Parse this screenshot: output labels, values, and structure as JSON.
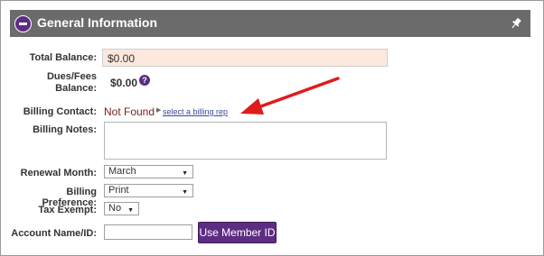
{
  "header": {
    "title": "General Information"
  },
  "fields": {
    "total_balance": {
      "label": "Total Balance:",
      "value": "$0.00"
    },
    "dues_fees_balance": {
      "label_line1": "Dues/Fees",
      "label_line2": "Balance:",
      "value": "$0.00",
      "help": "?"
    },
    "billing_contact": {
      "label": "Billing Contact:",
      "value": "Not Found",
      "link": "select a billing rep"
    },
    "billing_notes": {
      "label": "Billing Notes:",
      "value": ""
    },
    "renewal_month": {
      "label": "Renewal Month:",
      "selected": "March"
    },
    "billing_preference": {
      "label": "Billing Preference:",
      "selected": "Print"
    },
    "tax_exempt": {
      "label": "Tax Exempt:",
      "selected": "No"
    },
    "account_name_id": {
      "label": "Account Name/ID:",
      "value": ""
    }
  },
  "buttons": {
    "use_member_id": "Use Member ID"
  },
  "colors": {
    "header": "#6b6b6b",
    "accent": "#5c2d83",
    "highlight": "#fde8dd",
    "arrow": "#e01b1b"
  },
  "icons": {
    "collapse": "minus-circle-icon",
    "pin": "pin-icon",
    "help": "question-circle-icon",
    "caret": "caret-right-icon",
    "dropdown": "caret-down-icon"
  }
}
